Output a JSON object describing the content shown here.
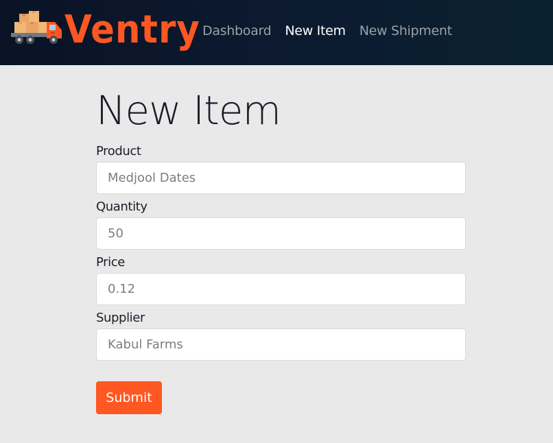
{
  "brand": {
    "name": "Ventry",
    "color": "#ff5722"
  },
  "nav": {
    "items": [
      {
        "label": "Dashboard",
        "active": false
      },
      {
        "label": "New Item",
        "active": true
      },
      {
        "label": "New Shipment",
        "active": false
      }
    ]
  },
  "page": {
    "title": "New Item"
  },
  "form": {
    "fields": [
      {
        "label": "Product",
        "value": "Medjool Dates"
      },
      {
        "label": "Quantity",
        "value": "50"
      },
      {
        "label": "Price",
        "value": "0.12"
      },
      {
        "label": "Supplier",
        "value": "Kabul Farms"
      }
    ],
    "submit_label": "Submit"
  },
  "colors": {
    "accent": "#ff5722",
    "navbar": "#0a1326",
    "background": "#e9e9e9"
  }
}
